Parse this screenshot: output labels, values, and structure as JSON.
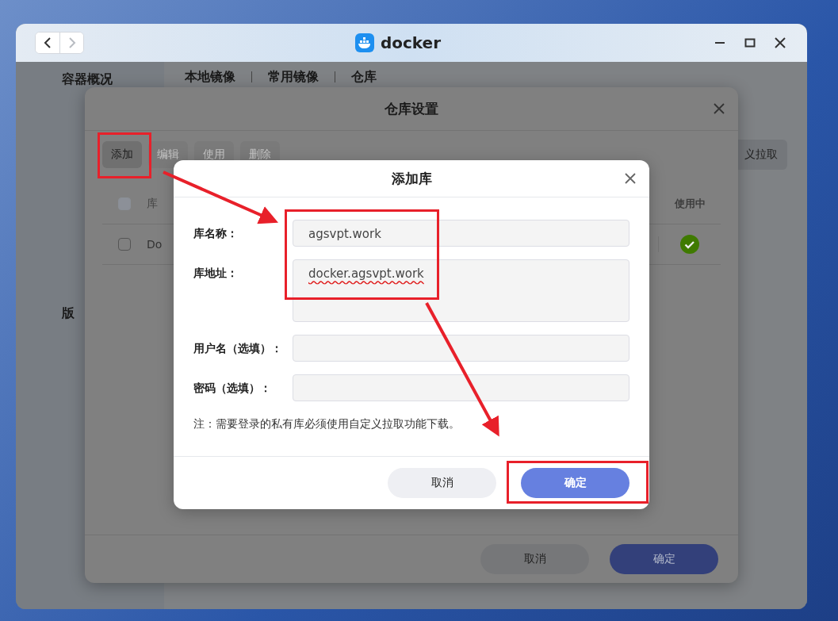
{
  "window": {
    "title": "docker",
    "back_disabled": false,
    "forward_disabled": true
  },
  "sidebar": {
    "items": [
      {
        "label": "容器概况"
      },
      {
        "label": "版"
      }
    ]
  },
  "tabs": [
    "本地镜像",
    "常用镜像",
    "仓库"
  ],
  "side_button": "义拉取",
  "settings_dialog": {
    "title": "仓库设置",
    "toolbar": [
      {
        "label": "添加",
        "disabled": false
      },
      {
        "label": "编辑",
        "disabled": true
      },
      {
        "label": "使用",
        "disabled": true
      },
      {
        "label": "删除",
        "disabled": true
      }
    ],
    "table": {
      "select_all_disabled": true,
      "columns": [
        "库",
        "使用中"
      ],
      "rows": [
        {
          "checked": false,
          "name": "Do",
          "in_use": true
        }
      ]
    },
    "buttons": [
      {
        "label": "取消",
        "kind": "secondary"
      },
      {
        "label": "确定",
        "kind": "primary"
      }
    ]
  },
  "add_dialog": {
    "title": "添加库",
    "fields": [
      {
        "label": "库名称：",
        "kind": "input",
        "value": "agsvpt.work"
      },
      {
        "label": "库地址：",
        "kind": "textarea",
        "value": "docker.agsvpt.work",
        "spell_error": true
      },
      {
        "label": "用户名（选填）：",
        "kind": "input"
      },
      {
        "label": "密码（选填）：",
        "kind": "input"
      }
    ],
    "note": "注：需要登录的私有库必须使用自定义拉取功能下载。",
    "buttons": [
      {
        "label": "取消",
        "kind": "secondary"
      },
      {
        "label": "确定",
        "kind": "primary"
      }
    ]
  }
}
